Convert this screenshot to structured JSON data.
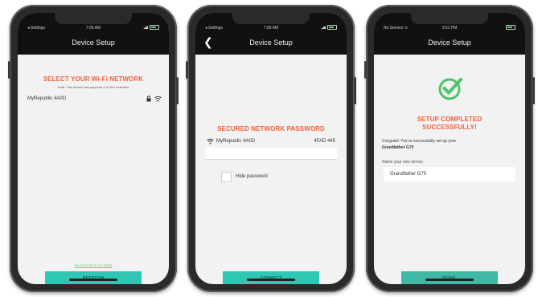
{
  "screens": [
    {
      "status": {
        "left": "◂ Settings",
        "time": "7:06 AM"
      },
      "title": "Device Setup",
      "heading": "SELECT YOUR Wi-Fi NETWORK",
      "note": "Note: This device only supports 2.4 GHz networks",
      "network": "MyRepublic 4A0D",
      "link": "My network is not listed",
      "button": "REFRESH"
    },
    {
      "status": {
        "left": "◂ Settings",
        "time": "7:06 AM"
      },
      "title": "Device Setup",
      "heading": "SECURED NETWORK PASSWORD",
      "network": "MyRepublic 4A0D",
      "network_extra": "4FAD 445",
      "hide_label": "Hide password",
      "button": "CONNECT"
    },
    {
      "status": {
        "left": "No Service ⊙",
        "time": "3:51 PM"
      },
      "title": "Device Setup",
      "heading_line1": "SETUP COMPLETED",
      "heading_line2": "SUCCESSFULLY!",
      "message": "Congrats! You've successfully set up your",
      "device_bold": "Grandfather G70",
      "name_label": "Name your new device",
      "device_name": "Grandfather G70",
      "button": "DONE"
    }
  ],
  "colors": {
    "accent_orange": "#f0603b",
    "teal": "#30c6b4",
    "check_green": "#4cc36a"
  }
}
